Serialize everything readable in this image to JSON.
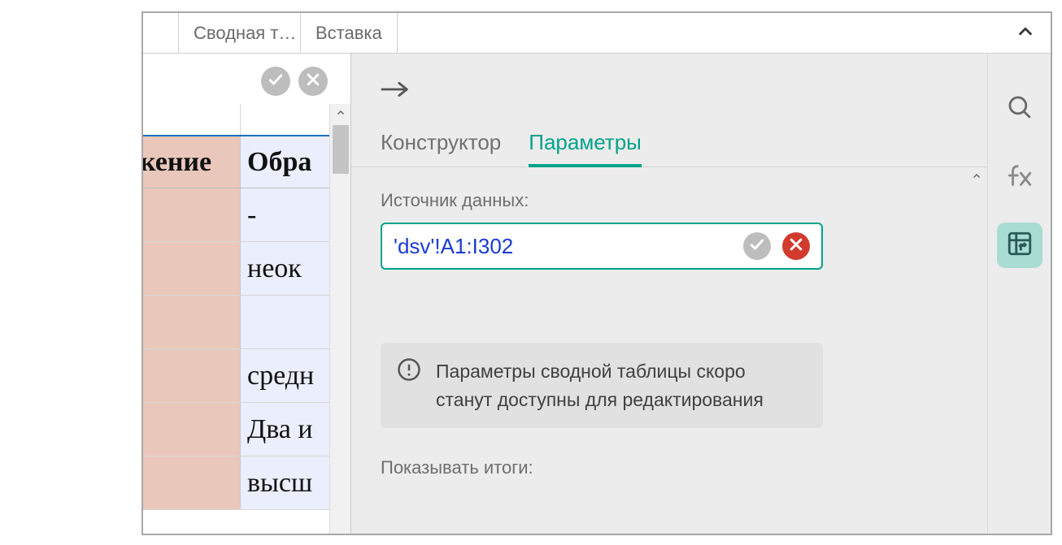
{
  "tabs": {
    "pivot": "Сводная т…",
    "insert": "Вставка"
  },
  "sheet": {
    "header_a": "кение",
    "header_b": "Обра",
    "rows": [
      {
        "a": "",
        "b": "-"
      },
      {
        "a": "",
        "b": "неок"
      },
      {
        "a": "",
        "b": ""
      },
      {
        "a": "",
        "b": "средн"
      },
      {
        "a": "",
        "b": "Два и"
      },
      {
        "a": "",
        "b": "высш"
      }
    ]
  },
  "panel": {
    "tab_designer": "Конструктор",
    "tab_params": "Параметры",
    "source_label": "Источник данных:",
    "source_value": "'dsv'!A1:I302",
    "info_text": "Параметры сводной таблицы скоро станут доступны для редактирования",
    "show_totals_label": "Показывать итоги:"
  }
}
